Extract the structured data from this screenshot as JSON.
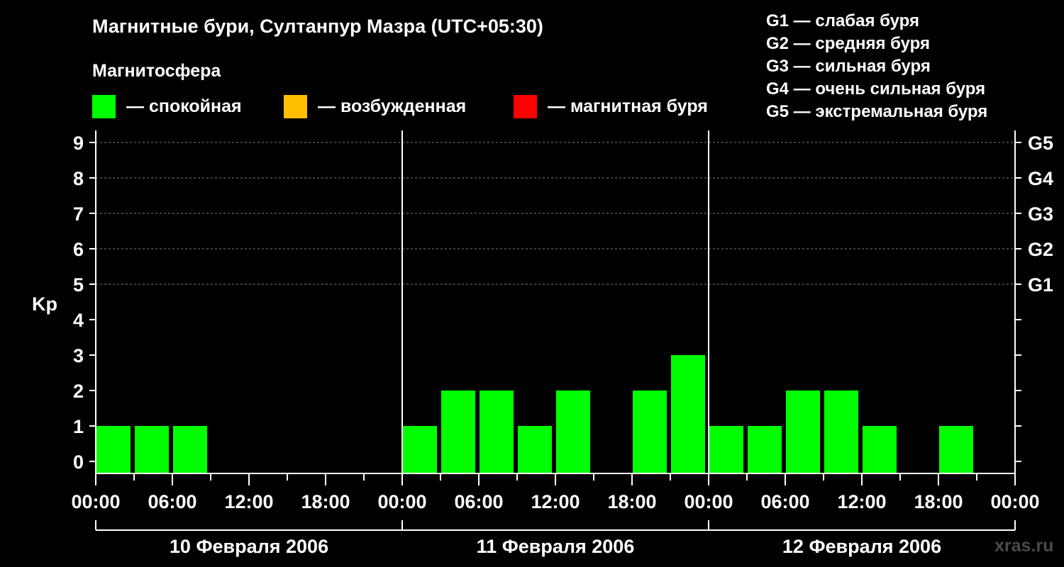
{
  "title": "Магнитные бури, Султанпур Мазра (UTC+05:30)",
  "magnetosphere_label": "Магнитосфера",
  "legend": [
    {
      "label": "— спокойная",
      "color": "#00ff00"
    },
    {
      "label": "— возбужденная",
      "color": "#ffbf00"
    },
    {
      "label": "— магнитная буря",
      "color": "#ff0000"
    }
  ],
  "g_legend": [
    "G1 — слабая буря",
    "G2 — средняя буря",
    "G3 — сильная буря",
    "G4 — очень сильная буря",
    "G5 — экстремальная буря"
  ],
  "watermark": "xras.ru",
  "chart_data": {
    "type": "bar",
    "title": "Магнитные бури, Султанпур Мазра (UTC+05:30)",
    "ylabel": "Kp",
    "ylim": [
      0,
      9
    ],
    "y_ticks": [
      0,
      1,
      2,
      3,
      4,
      5,
      6,
      7,
      8,
      9
    ],
    "g_ticks": [
      {
        "kp": 5,
        "label": "G1"
      },
      {
        "kp": 6,
        "label": "G2"
      },
      {
        "kp": 7,
        "label": "G3"
      },
      {
        "kp": 8,
        "label": "G4"
      },
      {
        "kp": 9,
        "label": "G5"
      }
    ],
    "x_tick_labels": [
      "00:00",
      "06:00",
      "12:00",
      "18:00",
      "00:00",
      "06:00",
      "12:00",
      "18:00",
      "00:00",
      "06:00",
      "12:00",
      "18:00",
      "00:00"
    ],
    "days": [
      "10 Февраля 2006",
      "11 Февраля 2006",
      "12 Февраля 2006"
    ],
    "bar_color": "#00ff00",
    "bars": [
      {
        "day": 0,
        "start_h": 0,
        "end_h": 3,
        "kp": 1
      },
      {
        "day": 0,
        "start_h": 3,
        "end_h": 6,
        "kp": 1
      },
      {
        "day": 0,
        "start_h": 6,
        "end_h": 9,
        "kp": 1
      },
      {
        "day": 1,
        "start_h": 0,
        "end_h": 3,
        "kp": 1
      },
      {
        "day": 1,
        "start_h": 3,
        "end_h": 6,
        "kp": 2
      },
      {
        "day": 1,
        "start_h": 6,
        "end_h": 9,
        "kp": 2
      },
      {
        "day": 1,
        "start_h": 9,
        "end_h": 12,
        "kp": 1
      },
      {
        "day": 1,
        "start_h": 12,
        "end_h": 15,
        "kp": 2
      },
      {
        "day": 1,
        "start_h": 18,
        "end_h": 21,
        "kp": 2
      },
      {
        "day": 1,
        "start_h": 21,
        "end_h": 24,
        "kp": 3
      },
      {
        "day": 2,
        "start_h": 0,
        "end_h": 3,
        "kp": 1
      },
      {
        "day": 2,
        "start_h": 3,
        "end_h": 6,
        "kp": 1
      },
      {
        "day": 2,
        "start_h": 6,
        "end_h": 9,
        "kp": 2
      },
      {
        "day": 2,
        "start_h": 9,
        "end_h": 12,
        "kp": 2
      },
      {
        "day": 2,
        "start_h": 12,
        "end_h": 15,
        "kp": 1
      },
      {
        "day": 2,
        "start_h": 18,
        "end_h": 21,
        "kp": 1
      }
    ]
  }
}
